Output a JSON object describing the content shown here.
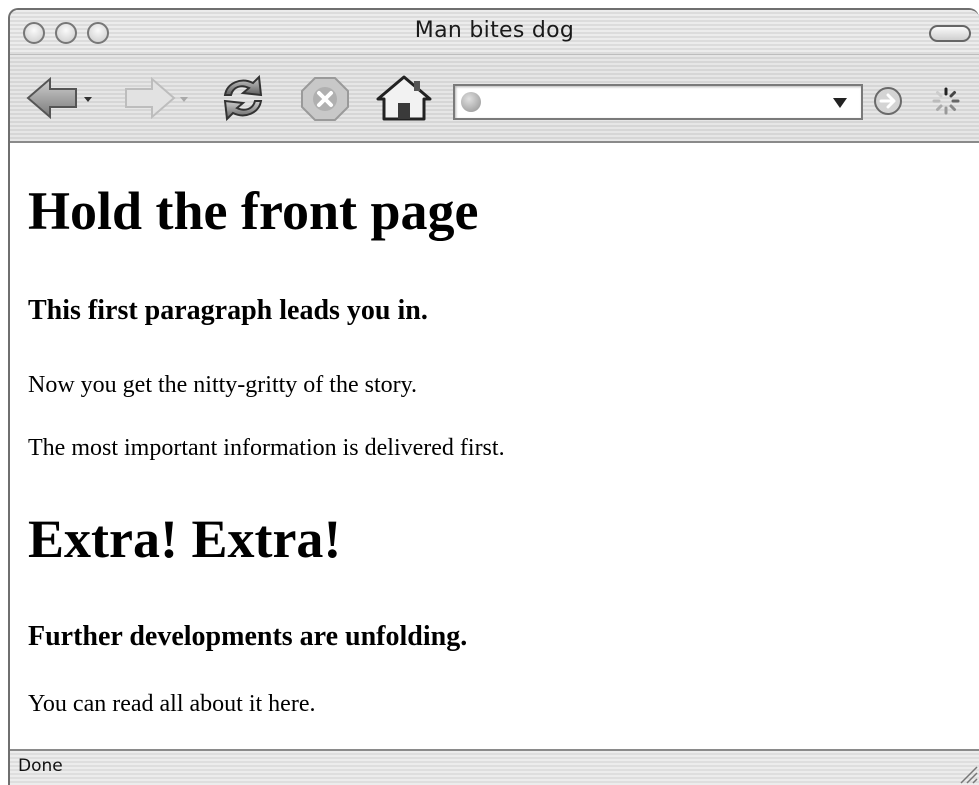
{
  "window": {
    "title": "Man bites dog"
  },
  "toolbar": {
    "back": "back-arrow-icon",
    "forward": "forward-arrow-icon",
    "reload": "reload-icon",
    "stop": "stop-icon",
    "home": "home-icon",
    "go": "go-arrow-icon",
    "throbber": "spinner-icon",
    "url_value": "",
    "url_placeholder": ""
  },
  "page": {
    "heading_1": "Hold the front page",
    "subheading_1": "This first paragraph leads you in.",
    "paragraph_1": "Now you get the nitty-gritty of the story.",
    "paragraph_2": "The most important information is delivered first.",
    "heading_2": "Extra! Extra!",
    "subheading_2": "Further developments are unfolding.",
    "paragraph_3": "You can read all about it here."
  },
  "status": {
    "text": "Done"
  }
}
